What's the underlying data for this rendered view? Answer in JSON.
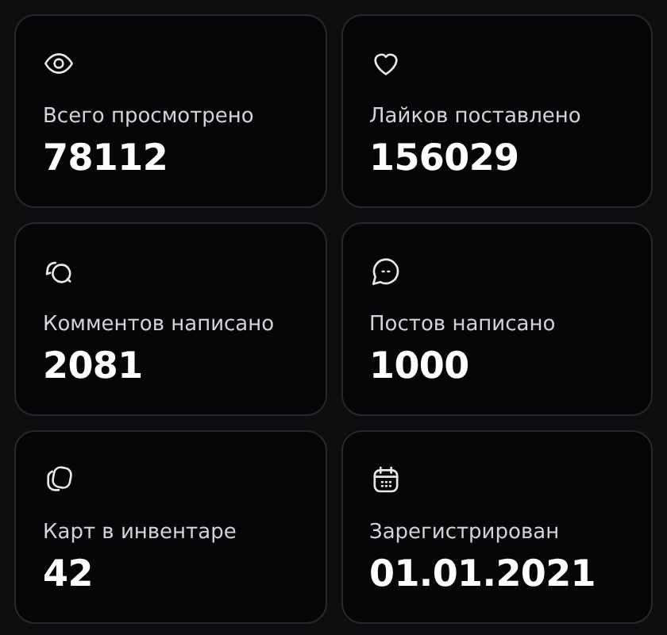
{
  "stats": [
    {
      "label": "Всего просмотрено",
      "value": "78112"
    },
    {
      "label": "Лайков поставлено",
      "value": "156029"
    },
    {
      "label": "Комментов написано",
      "value": "2081"
    },
    {
      "label": "Постов написано",
      "value": "1000"
    },
    {
      "label": "Карт в инвентаре",
      "value": "42"
    },
    {
      "label": "Зарегистрирован",
      "value": "01.01.2021"
    }
  ]
}
